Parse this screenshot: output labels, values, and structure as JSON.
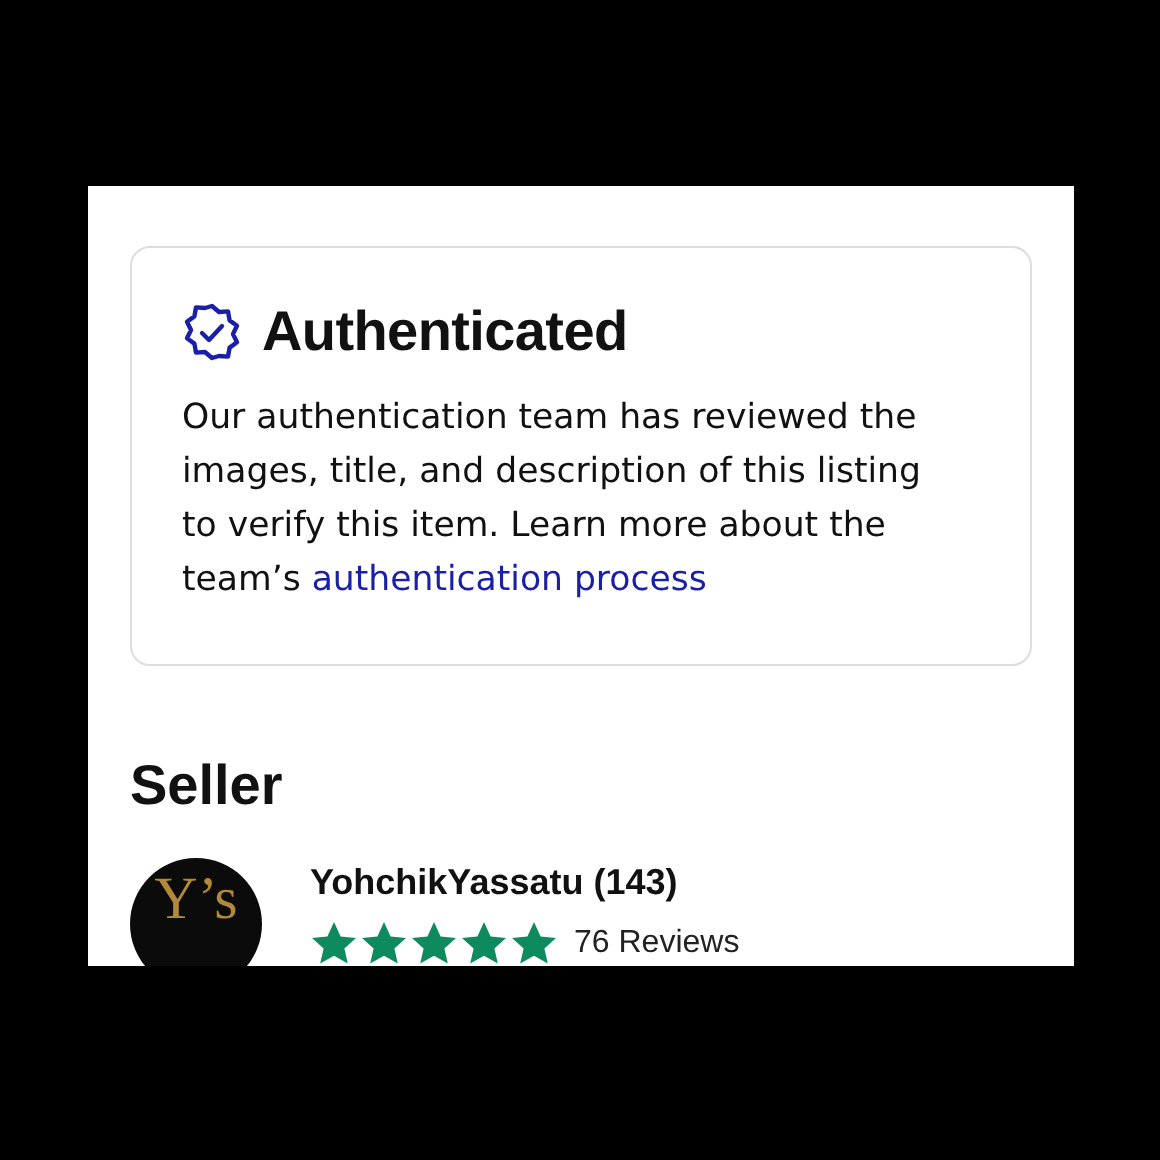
{
  "authentication": {
    "title": "Authenticated",
    "description": "Our authentication team has reviewed the images, title, and description of this listing to verify this item. Learn more about the team’s",
    "link": "authentication process"
  },
  "seller": {
    "heading": "Seller",
    "avatar_logo": "Y’s",
    "name": "YohchikYassatu (143)",
    "stars": 5,
    "reviews": "76 Reviews"
  }
}
